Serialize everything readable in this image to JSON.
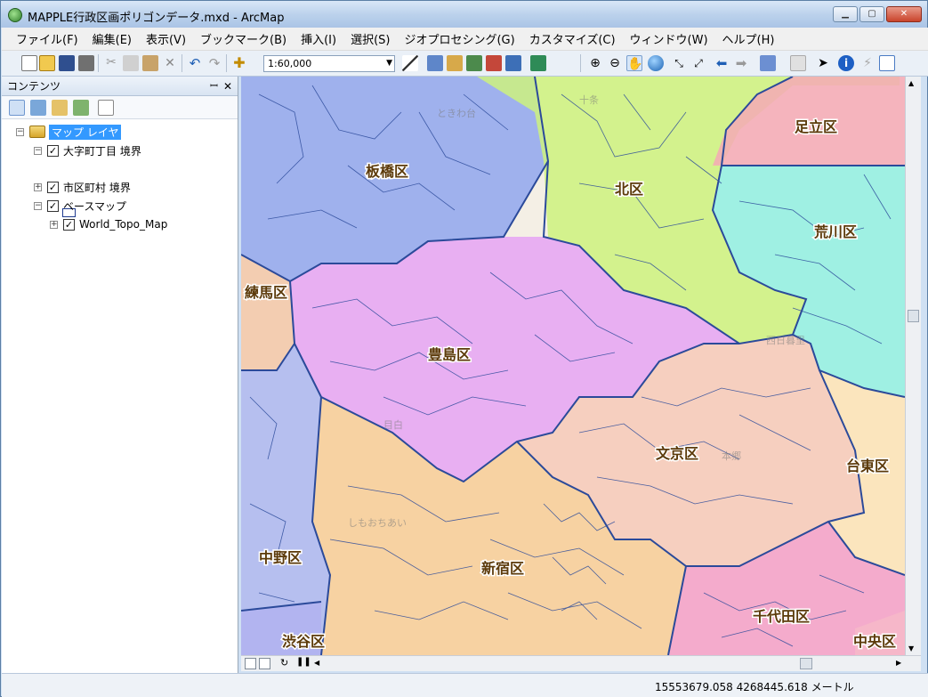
{
  "window": {
    "title": "MAPPLE行政区画ポリゴンデータ.mxd - ArcMap",
    "min_label": "▁",
    "max_label": "▢",
    "close_label": "✕"
  },
  "menu": [
    "ファイル(F)",
    "編集(E)",
    "表示(V)",
    "ブックマーク(B)",
    "挿入(I)",
    "選択(S)",
    "ジオプロセシング(G)",
    "カスタマイズ(C)",
    "ウィンドウ(W)",
    "ヘルプ(H)"
  ],
  "toolbar": {
    "scale_value": "1:60,000"
  },
  "toc": {
    "title": "コンテンツ",
    "pin": "ꟷ",
    "close": "✕",
    "map_layers": "マップ レイヤ",
    "layers": [
      {
        "name": "大字町丁目 境界",
        "checked": true,
        "expanded": true
      },
      {
        "name": "市区町村 境界",
        "checked": true,
        "expanded": false
      },
      {
        "name": "ベースマップ",
        "checked": true,
        "expanded": true
      },
      {
        "name": "World_Topo_Map",
        "checked": true,
        "expanded": false
      }
    ]
  },
  "map": {
    "wards": [
      {
        "name": "板橋区",
        "color": "#8fa6ee"
      },
      {
        "name": "北区",
        "color": "#cdf27e"
      },
      {
        "name": "足立区",
        "color": "#f4a9b6"
      },
      {
        "name": "荒川区",
        "color": "#8ff0e3"
      },
      {
        "name": "練馬区",
        "color": "#f2c7a8"
      },
      {
        "name": "豊島区",
        "color": "#e5a3f4"
      },
      {
        "name": "文京区",
        "color": "#f6c9b8"
      },
      {
        "name": "台東区",
        "color": "#fbe3b6"
      },
      {
        "name": "中野区",
        "color": "#aab6f1"
      },
      {
        "name": "新宿区",
        "color": "#f7cd97"
      },
      {
        "name": "千代田区",
        "color": "#f39fc8"
      },
      {
        "name": "渋谷区",
        "color": "#b2b2f0"
      },
      {
        "name": "中央区",
        "color": "#f6b9c8"
      }
    ],
    "boundary_color": "#2b4a9a"
  },
  "status": {
    "x": "15553679.058",
    "y": "4268445.618",
    "unit": "メートル"
  }
}
